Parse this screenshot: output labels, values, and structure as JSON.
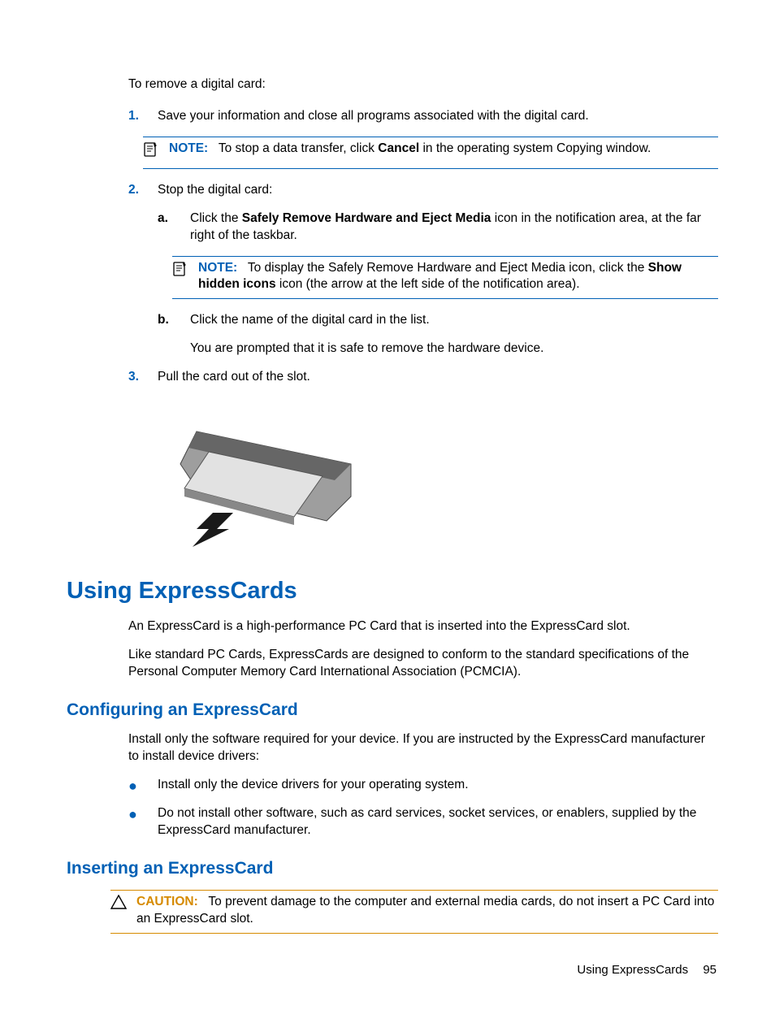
{
  "intro": "To remove a digital card:",
  "steps": {
    "s1": {
      "num": "1.",
      "text": "Save your information and close all programs associated with the digital card."
    },
    "note1": {
      "label": "NOTE:",
      "before": "To stop a data transfer, click ",
      "bold": "Cancel",
      "after": " in the operating system Copying window."
    },
    "s2": {
      "num": "2.",
      "text": "Stop the digital card:"
    },
    "s2a": {
      "let": "a.",
      "before": "Click the ",
      "bold": "Safely Remove Hardware and Eject Media",
      "after": " icon in the notification area, at the far right of the taskbar."
    },
    "note2": {
      "label": "NOTE:",
      "before": "To display the Safely Remove Hardware and Eject Media icon, click the ",
      "bold": "Show hidden icons",
      "after": " icon (the arrow at the left side of the notification area)."
    },
    "s2b": {
      "let": "b.",
      "text": "Click the name of the digital card in the list."
    },
    "s2b_tail": "You are prompted that it is safe to remove the hardware device.",
    "s3": {
      "num": "3.",
      "text": "Pull the card out of the slot."
    }
  },
  "h1": "Using ExpressCards",
  "p1": "An ExpressCard is a high-performance PC Card that is inserted into the ExpressCard slot.",
  "p2": "Like standard PC Cards, ExpressCards are designed to conform to the standard specifications of the Personal Computer Memory Card International Association (PCMCIA).",
  "h2a": "Configuring an ExpressCard",
  "p3": "Install only the software required for your device. If you are instructed by the ExpressCard manufacturer to install device drivers:",
  "bul1": "Install only the device drivers for your operating system.",
  "bul2": "Do not install other software, such as card services, socket services, or enablers, supplied by the ExpressCard manufacturer.",
  "h2b": "Inserting an ExpressCard",
  "caution": {
    "label": "CAUTION:",
    "text": "To prevent damage to the computer and external media cards, do not insert a PC Card into an ExpressCard slot."
  },
  "footer": {
    "title": "Using ExpressCards",
    "page": "95"
  }
}
